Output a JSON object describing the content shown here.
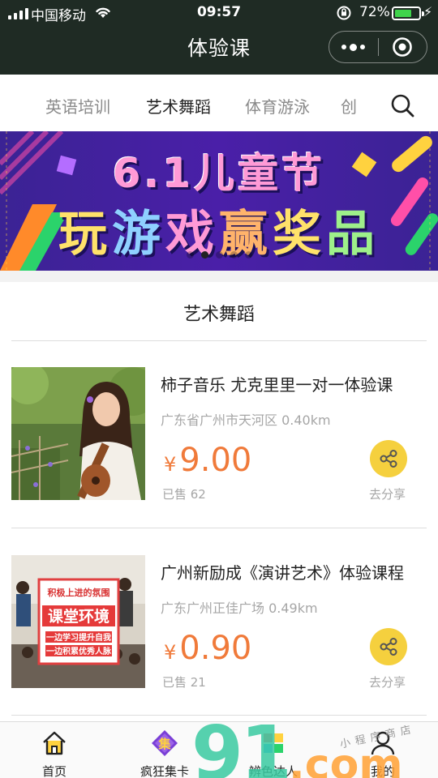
{
  "status_bar": {
    "carrier": "中国移动",
    "time": "09:57",
    "battery_percent": "72%",
    "battery_level": 0.72
  },
  "header": {
    "title": "体验课"
  },
  "tabs": [
    {
      "label": "英语培训",
      "active": false
    },
    {
      "label": "艺术舞蹈",
      "active": true
    },
    {
      "label": "体育游泳",
      "active": false
    },
    {
      "label": "创",
      "active": false
    }
  ],
  "banner": {
    "line1": "6.1儿童节",
    "line2": [
      "玩",
      "游",
      "戏",
      "赢",
      "奖",
      "品"
    ],
    "slide_count": 5,
    "active_slide": 1
  },
  "section": {
    "title": "艺术舞蹈"
  },
  "courses": [
    {
      "title": "柿子音乐 尤克里里一对一体验课",
      "address": "广东省广州市天河区 0.40km",
      "currency": "¥",
      "price": "9.00",
      "sold": "已售 62",
      "share_label": "去分享"
    },
    {
      "title": "广州新励成《演讲艺术》体验课程",
      "address": "广东广州正佳广场 0.49km",
      "currency": "¥",
      "price": "0.90",
      "sold": "已售 21",
      "share_label": "去分享",
      "poster": {
        "top": "积极上进的氛围",
        "main": "课堂环境",
        "line1": "一边学习提升自我",
        "line2": "一边积累优秀人脉"
      }
    }
  ],
  "bottom_nav": [
    {
      "label": "首页",
      "icon": "home-icon"
    },
    {
      "label": "疯狂集卡",
      "icon": "card-collect-icon",
      "badge": "集"
    },
    {
      "label": "辨色达人",
      "icon": "color-icon"
    },
    {
      "label": "我的",
      "icon": "profile-icon"
    }
  ],
  "watermark": {
    "text": "91",
    "suffix": ".com",
    "small": "小程序商店"
  },
  "colors": {
    "header_bg": "#1f2b24",
    "price": "#f07a3a",
    "share_btn": "#f5d03e",
    "banner_bg": "#4a1fa8"
  }
}
